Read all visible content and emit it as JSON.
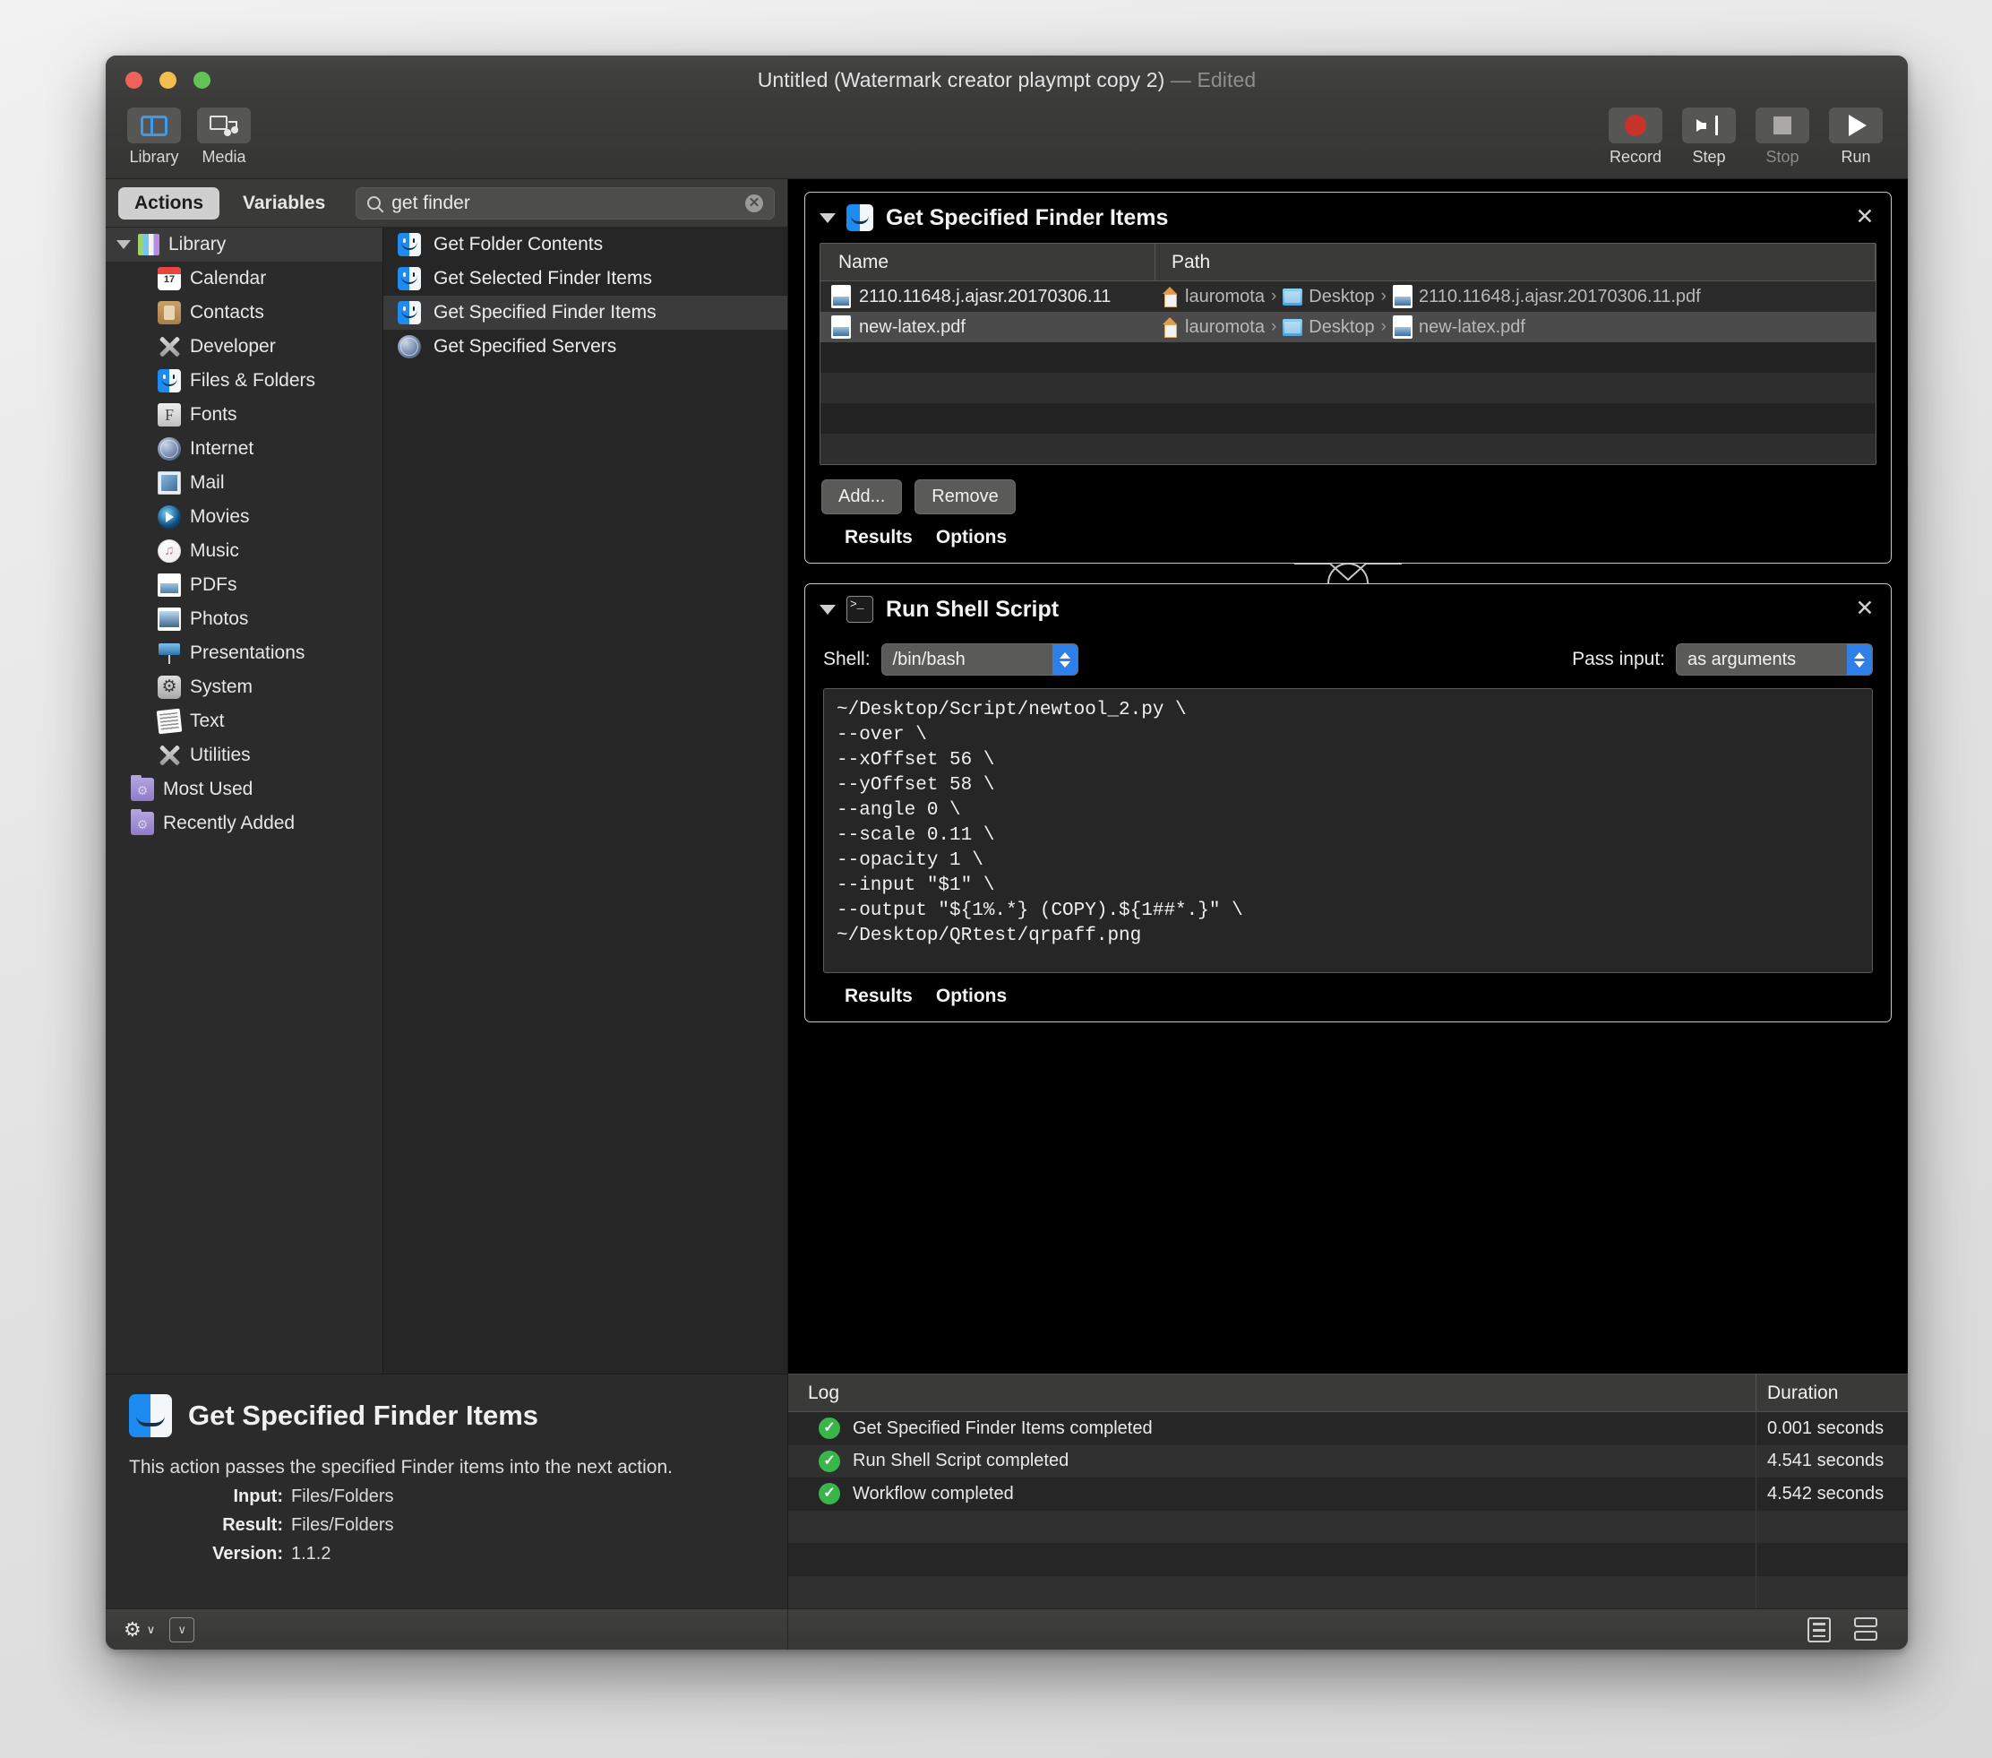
{
  "window": {
    "title_main": "Untitled (Watermark creator plaympt copy 2)",
    "title_sep": "—",
    "title_state": "Edited"
  },
  "toolbar": {
    "left": [
      {
        "label": "Library",
        "icon": "library-icon"
      },
      {
        "label": "Media",
        "icon": "media-icon"
      }
    ],
    "right": [
      {
        "label": "Record",
        "icon": "record-icon"
      },
      {
        "label": "Step",
        "icon": "step-icon"
      },
      {
        "label": "Stop",
        "icon": "stop-icon"
      },
      {
        "label": "Run",
        "icon": "run-icon"
      }
    ]
  },
  "sidebar": {
    "tabs": [
      {
        "label": "Actions",
        "active": true
      },
      {
        "label": "Variables",
        "active": false
      }
    ],
    "search": {
      "value": "get finder",
      "placeholder": "Search"
    },
    "tree_root": "Library",
    "tree_items": [
      "Calendar",
      "Contacts",
      "Developer",
      "Files & Folders",
      "Fonts",
      "Internet",
      "Mail",
      "Movies",
      "Music",
      "PDFs",
      "Photos",
      "Presentations",
      "System",
      "Text",
      "Utilities"
    ],
    "tree_groups": [
      "Most Used",
      "Recently Added"
    ],
    "actions": [
      {
        "label": "Get Folder Contents",
        "selected": false,
        "icon": "finder-icon"
      },
      {
        "label": "Get Selected Finder Items",
        "selected": false,
        "icon": "finder-icon"
      },
      {
        "label": "Get Specified Finder Items",
        "selected": true,
        "icon": "finder-icon"
      },
      {
        "label": "Get Specified Servers",
        "selected": false,
        "icon": "globe-icon"
      }
    ]
  },
  "description": {
    "title": "Get Specified Finder Items",
    "text": "This action passes the specified Finder items into the next action.",
    "fields": [
      {
        "key": "Input:",
        "value": "Files/Folders"
      },
      {
        "key": "Result:",
        "value": "Files/Folders"
      },
      {
        "key": "Version:",
        "value": "1.1.2"
      }
    ]
  },
  "workflow": {
    "action1": {
      "title": "Get Specified Finder Items",
      "columns": [
        "Name",
        "Path"
      ],
      "rows": [
        {
          "name": "2110.11648.j.ajasr.20170306.11",
          "path": [
            "lauromota",
            "Desktop",
            "2110.11648.j.ajasr.20170306.11.pdf"
          ]
        },
        {
          "name": "new-latex.pdf",
          "path": [
            "lauromota",
            "Desktop",
            "new-latex.pdf"
          ]
        }
      ],
      "buttons": [
        "Add...",
        "Remove"
      ],
      "tabs": [
        "Results",
        "Options"
      ],
      "close_label": "✕"
    },
    "action2": {
      "title": "Run Shell Script",
      "shell_label": "Shell:",
      "shell_value": "/bin/bash",
      "pass_input_label": "Pass input:",
      "pass_input_value": "as arguments",
      "script": "~/Desktop/Script/newtool_2.py \\\n--over \\\n--xOffset 56 \\\n--yOffset 58 \\\n--angle 0 \\\n--scale 0.11 \\\n--opacity 1 \\\n--input \"$1\" \\\n--output \"${1%.*} (COPY).${1##*.}\" \\\n~/Desktop/QRtest/qrpaff.png",
      "tabs": [
        "Results",
        "Options"
      ],
      "close_label": "✕"
    }
  },
  "log": {
    "columns": [
      "Log",
      "Duration"
    ],
    "rows": [
      {
        "message": "Get Specified Finder Items completed",
        "duration": "0.001 seconds",
        "status": "ok"
      },
      {
        "message": "Run Shell Script completed",
        "duration": "4.541 seconds",
        "status": "ok"
      },
      {
        "message": "Workflow completed",
        "duration": "4.542 seconds",
        "status": "ok"
      }
    ],
    "status_glyph": "✓"
  },
  "statusbar": {
    "gear_glyph": "⚙",
    "caret_glyph": "∨",
    "box_glyph": "∨"
  },
  "colors": {
    "accent_blue": "#2f7fe8",
    "record_red": "#c6332a",
    "success_green": "#39b54a",
    "window_bg": "#2b2b2b",
    "canvas_bg": "#000000"
  }
}
